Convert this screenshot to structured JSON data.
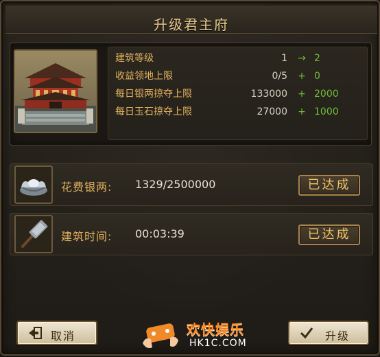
{
  "dialog": {
    "title": "升级君主府"
  },
  "stats": [
    {
      "label": "建筑等级",
      "current": "1",
      "op": "→",
      "bonus": "2"
    },
    {
      "label": "收益领地上限",
      "current": "0/5",
      "op": "+",
      "bonus": "0"
    },
    {
      "label": "每日银两掠夺上限",
      "current": "133000",
      "op": "+",
      "bonus": "2000"
    },
    {
      "label": "每日玉石掠夺上限",
      "current": "27000",
      "op": "+",
      "bonus": "1000"
    }
  ],
  "requirements": [
    {
      "label": "花费银两:",
      "value": "1329/2500000",
      "status": "已达成",
      "icon": "silver-ingot-icon"
    },
    {
      "label": "建筑时间:",
      "value": "00:03:39",
      "status": "已达成",
      "icon": "hammer-icon"
    }
  ],
  "buttons": {
    "cancel_label": "取消",
    "upgrade_label": "升级"
  },
  "watermark": {
    "cn": "欢快娱乐",
    "en": "HK1C.COM"
  },
  "colors": {
    "gold_text": "#e2b15e",
    "green_bonus": "#6fbf3a",
    "title": "#e6c88a"
  }
}
